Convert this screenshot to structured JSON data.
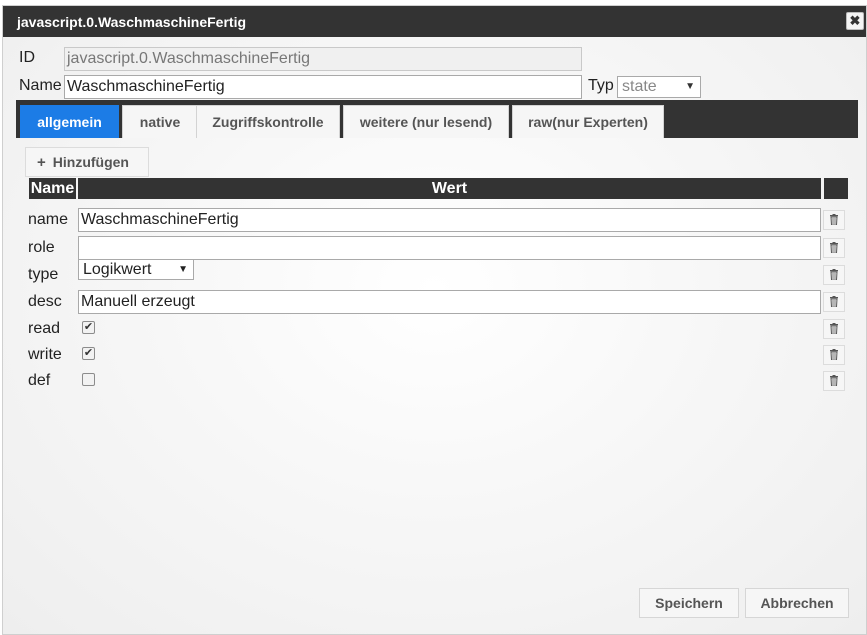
{
  "dialog": {
    "title": "javascript.0.WaschmaschineFertig",
    "close_symbol": "✖"
  },
  "fields": {
    "id_label": "ID",
    "id_value": "javascript.0.WaschmaschineFertig",
    "name_label": "Name",
    "name_value": "WaschmaschineFertig",
    "typ_label": "Typ",
    "typ_value": "state"
  },
  "tabs": [
    {
      "label": "allgemein",
      "active": true
    },
    {
      "label": "native"
    },
    {
      "label": "Zugriffskontrolle"
    },
    {
      "label": "weitere (nur lesend)"
    },
    {
      "label": "raw(nur Experten)"
    }
  ],
  "toolbar": {
    "add_label": "Hinzufügen"
  },
  "table": {
    "headers": [
      "Name",
      "Wert"
    ],
    "rows": [
      {
        "name": "name",
        "value": "WaschmaschineFertig"
      },
      {
        "name": "role",
        "value": ""
      },
      {
        "name": "type",
        "value": "Logikwert"
      },
      {
        "name": "desc",
        "value": "Manuell erzeugt"
      },
      {
        "name": "read",
        "checked": true
      },
      {
        "name": "write",
        "checked": true
      },
      {
        "name": "def",
        "checked": false
      }
    ]
  },
  "footer": {
    "save_label": "Speichern",
    "cancel_label": "Abbrechen"
  },
  "icons": {
    "delete": "trash-icon",
    "add": "plus-icon",
    "close": "close-icon"
  },
  "colors": {
    "accent": "#1c7ce6",
    "header_bg": "#333333"
  }
}
